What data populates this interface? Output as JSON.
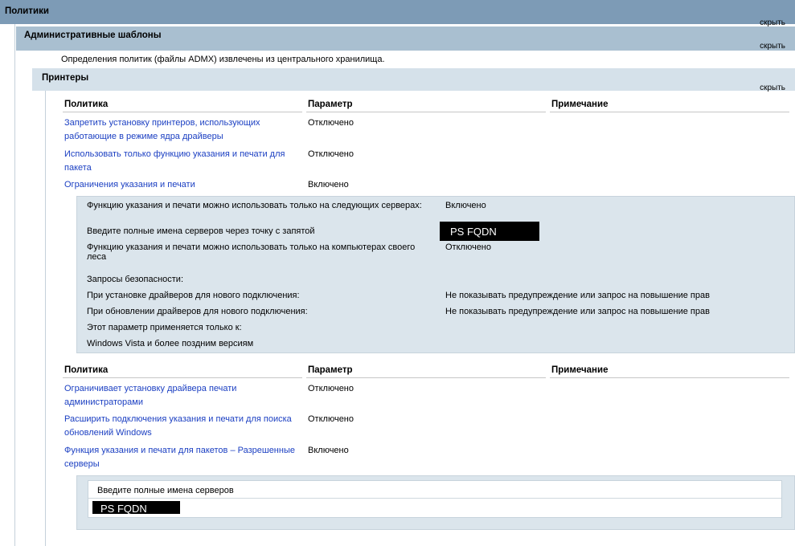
{
  "hide_label": "скрыть",
  "policies": {
    "title": "Политики"
  },
  "admin_templates": {
    "title": "Административные шаблоны",
    "note": "Определения политик (файлы ADMX) извлечены из центрального хранилища."
  },
  "printers": {
    "title": "Принтеры",
    "table_headers": {
      "policy": "Политика",
      "setting": "Параметр",
      "comment": "Примечание"
    },
    "group1": [
      {
        "policy": "Запретить установку принтеров, использующих работающие в режиме ядра драйверы",
        "setting": "Отключено"
      },
      {
        "policy": "Использовать только функцию указания и печати для пакета",
        "setting": "Отключено"
      },
      {
        "policy": "Ограничения указания и печати",
        "setting": "Включено"
      }
    ],
    "detail1": {
      "rows": [
        {
          "label": "Функцию указания и печати можно использовать только на следующих серверах:",
          "value": "Включено"
        },
        {
          "label": "Введите полные имена серверов через точку с запятой",
          "value": "PS FQDN"
        },
        {
          "label": "Функцию указания и печати можно использовать только на компьютерах своего леса",
          "value": "Отключено"
        },
        {
          "label": "Запросы безопасности:",
          "value": ""
        },
        {
          "label": "При установке драйверов для нового подключения:",
          "value": "Не показывать предупреждение или запрос на повышение прав"
        },
        {
          "label": "При обновлении драйверов для нового подключения:",
          "value": "Не показывать предупреждение или запрос на повышение прав"
        },
        {
          "label": "Этот параметр применяется только к:",
          "value": ""
        },
        {
          "label": "Windows Vista и более поздним версиям",
          "value": ""
        }
      ]
    },
    "group2": [
      {
        "policy": "Ограничивает установку драйвера печати администраторами",
        "setting": "Отключено"
      },
      {
        "policy": "Расширить подключения указания и печати для поиска обновлений Windows",
        "setting": "Отключено"
      },
      {
        "policy": "Функция указания и печати для пакетов – Разрешенные серверы",
        "setting": "Включено"
      }
    ],
    "detail2": {
      "label": "Введите полные имена серверов",
      "value": "PS FQDN"
    }
  }
}
